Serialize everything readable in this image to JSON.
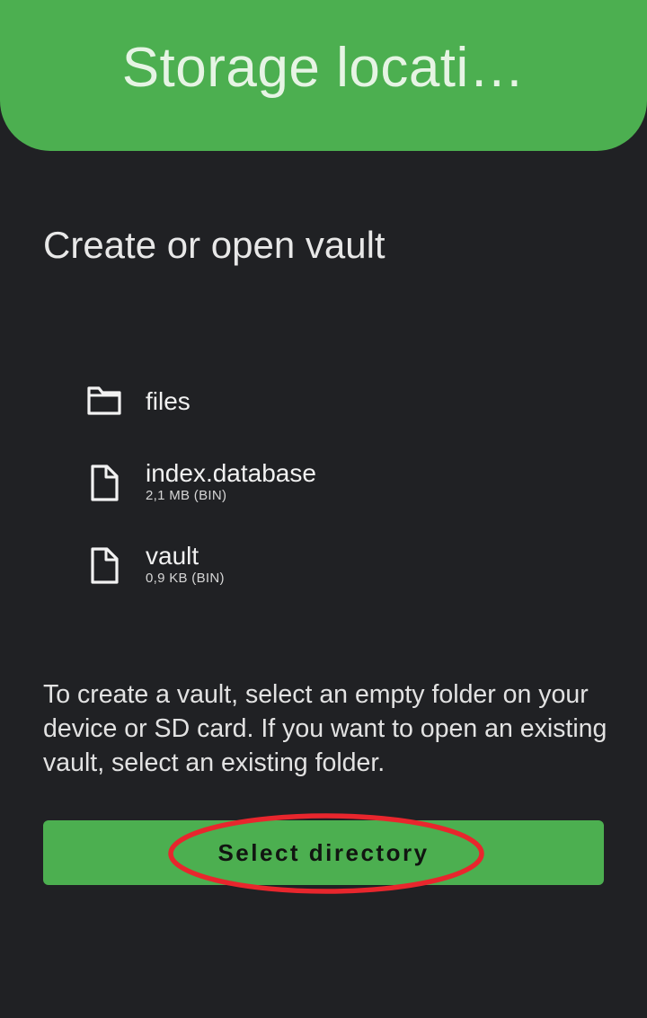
{
  "header": {
    "title": "Storage locati…",
    "color": "#4caf50"
  },
  "main": {
    "heading": "Create or open vault",
    "files": [
      {
        "name": "files",
        "meta": "",
        "icon": "folder-icon"
      },
      {
        "name": "index.database",
        "meta": "2,1 MB (BIN)",
        "icon": "file-icon"
      },
      {
        "name": "vault",
        "meta": "0,9 KB (BIN)",
        "icon": "file-icon"
      }
    ],
    "description": "To create a vault, select an empty folder on your device or SD card. If you want to open an existing vault, select an existing folder.",
    "select_button_label": "Select directory"
  },
  "annotation": {
    "highlight_color": "#e8262d",
    "highlight_shape": "ellipse"
  }
}
